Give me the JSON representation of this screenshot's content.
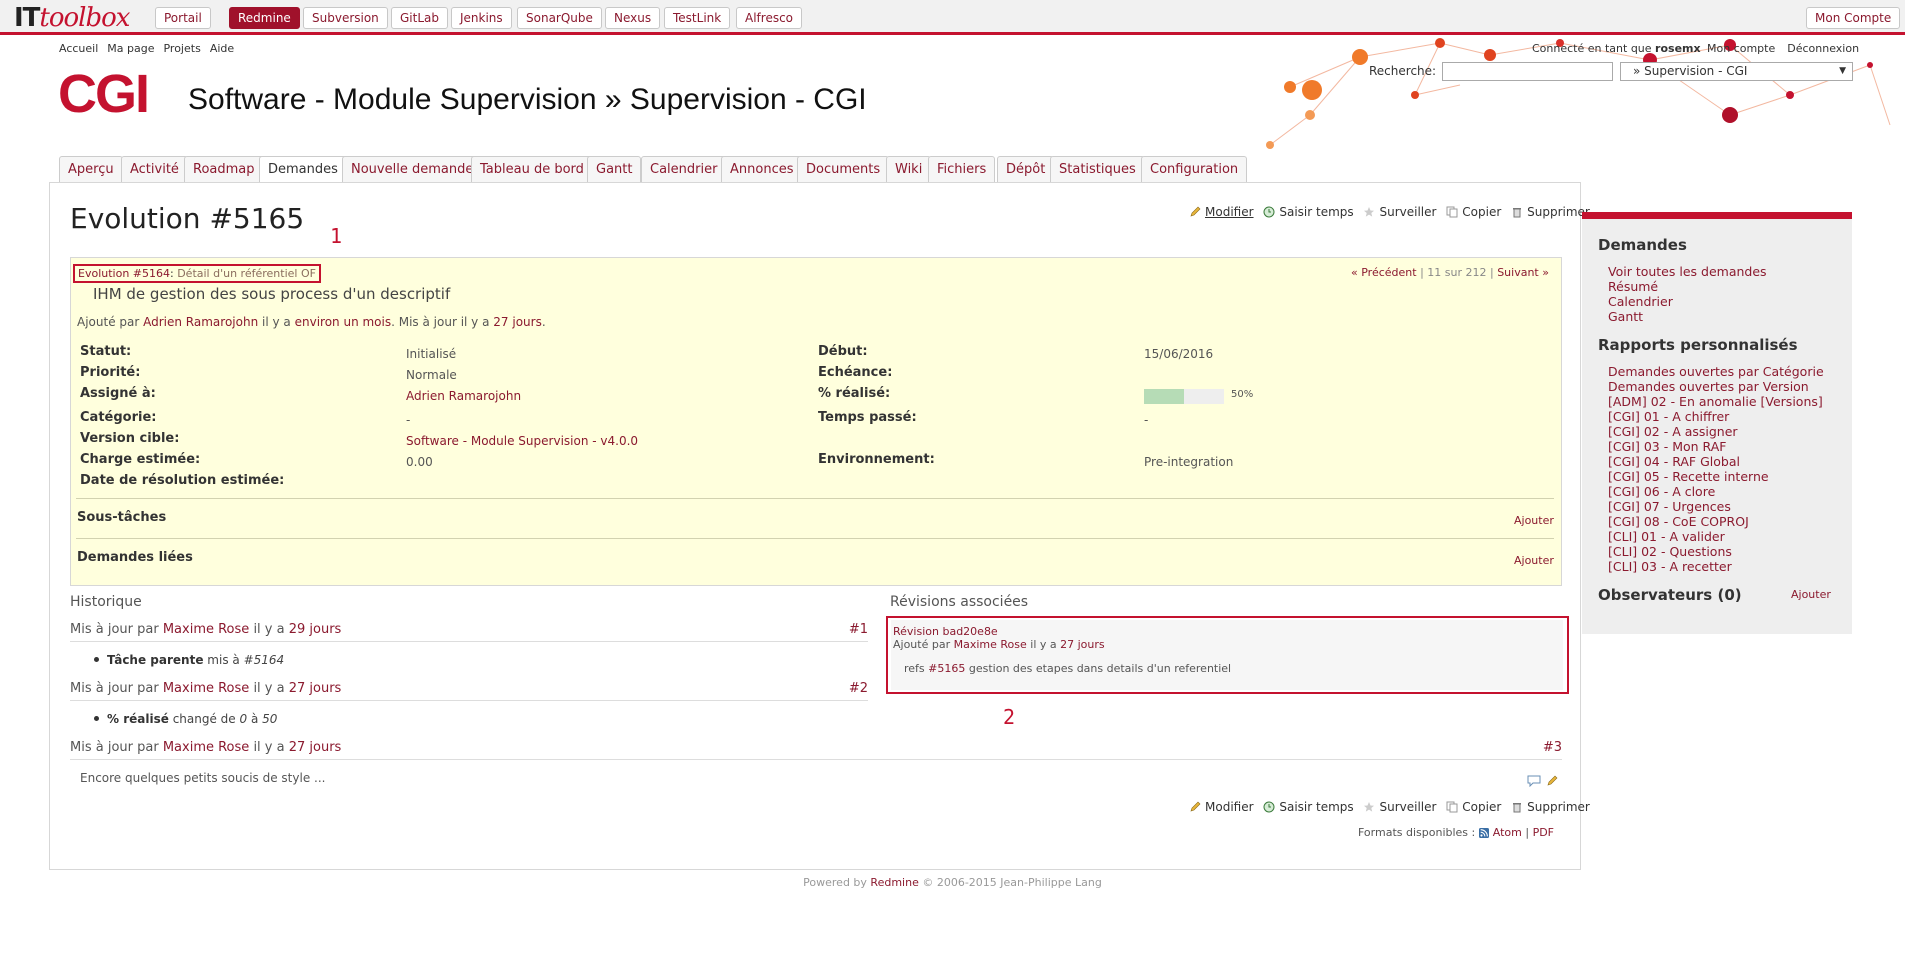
{
  "toolbar": {
    "logo_it": "IT",
    "logo_rest": "toolbox",
    "buttons": [
      "Portail",
      "Redmine",
      "Subversion",
      "GitLab",
      "Jenkins",
      "SonarQube",
      "Nexus",
      "TestLink",
      "Alfresco"
    ],
    "active": "Redmine",
    "account": "Mon Compte"
  },
  "header": {
    "menu_left": [
      "Accueil",
      "Ma page",
      "Projets",
      "Aide"
    ],
    "loggedas_prefix": "Connecté en tant que",
    "loggedas_user": "rosemx",
    "menu_right": [
      "Mon compte",
      "Déconnexion"
    ],
    "logo": "CGI",
    "title": "Software - Module Supervision » Supervision - CGI",
    "search_label": "Recherche:",
    "search_value": "",
    "project_select": "» Supervision - CGI"
  },
  "tabs": [
    "Aperçu",
    "Activité",
    "Roadmap",
    "Demandes",
    "Nouvelle demande",
    "Tableau de bord",
    "Gantt",
    "Calendrier",
    "Annonces",
    "Documents",
    "Wiki",
    "Fichiers",
    "Dépôt",
    "Statistiques",
    "Configuration"
  ],
  "selected_tab": "Demandes",
  "issue": {
    "title": "Evolution #5165",
    "actions": [
      "Modifier",
      "Saisir temps",
      "Surveiller",
      "Copier",
      "Supprimer"
    ],
    "parent_link": "Evolution #5164",
    "parent_subject": "Détail d'un référentiel OF",
    "subject": "IHM de gestion des sous process d'un descriptif",
    "author_prefix": "Ajouté par",
    "author": "Adrien Ramarojohn",
    "author_mid": "il y a",
    "created": "environ un mois",
    "updated_mid": ". Mis à jour il y a",
    "updated": "27 jours",
    "nav_prev": "« Précédent",
    "nav_count": "11 sur 212",
    "nav_next": "Suivant »",
    "attributes": {
      "statut_l": "Statut:",
      "statut_v": "Initialisé",
      "priorite_l": "Priorité:",
      "priorite_v": "Normale",
      "assigne_l": "Assigné à:",
      "assigne_v": "Adrien Ramarojohn",
      "categorie_l": "Catégorie:",
      "categorie_v": "-",
      "version_l": "Version cible:",
      "version_v": "Software - Module Supervision - v4.0.0",
      "charge_l": "Charge estimée:",
      "charge_v": "0.00",
      "date_res_l": "Date de résolution estimée:",
      "debut_l": "Début:",
      "debut_v": "15/06/2016",
      "echeance_l": "Echéance:",
      "realise_l": "% réalisé:",
      "realise_pct": 50,
      "realise_txt": "50%",
      "temps_l": "Temps passé:",
      "temps_v": "-",
      "env_l": "Environnement:",
      "env_v": "Pre-integration"
    },
    "subtasks": "Sous-tâches",
    "related": "Demandes liées",
    "add": "Ajouter"
  },
  "history": {
    "title": "Historique",
    "journals": [
      {
        "prefix": "Mis à jour par",
        "user": "Maxime Rose",
        "mid": "il y a",
        "ago": "29 jours",
        "num": "#1"
      },
      {
        "prefix": "Mis à jour par",
        "user": "Maxime Rose",
        "mid": "il y a",
        "ago": "27 jours",
        "num": "#2"
      },
      {
        "prefix": "Mis à jour par",
        "user": "Maxime Rose",
        "mid": "il y a",
        "ago": "27 jours",
        "num": "#3"
      }
    ],
    "detail1_label": "Tâche parente",
    "detail1_text": "mis à",
    "detail1_val": "#5164",
    "detail2_label": "% réalisé",
    "detail2_text": "changé de",
    "detail2_from": "0",
    "detail2_to_word": "à",
    "detail2_to": "50",
    "note": "Encore quelques petits soucis de style ..."
  },
  "revisions": {
    "title": "Révisions associées",
    "rev": "Révision bad20e8e",
    "author_prefix": "Ajouté par",
    "author": "Maxime Rose",
    "author_mid": "il y a",
    "ago": "27 jours",
    "msg_prefix": "refs",
    "msg_ref": "#5165",
    "msg_text": "gestion des etapes dans details d'un referentiel"
  },
  "annotations": {
    "one": "1",
    "two": "2"
  },
  "formats": {
    "label": "Formats disponibles :",
    "atom": "Atom",
    "sep": "|",
    "pdf": "PDF"
  },
  "sidebar": {
    "h_demandes": "Demandes",
    "demandes_links": [
      "Voir toutes les demandes",
      "Résumé",
      "Calendrier",
      "Gantt"
    ],
    "h_rapports": "Rapports personnalisés",
    "rapports_links": [
      "Demandes ouvertes par Catégorie",
      "Demandes ouvertes par Version",
      "[ADM] 02 - En anomalie [Versions]",
      "[CGI] 01 - A chiffrer",
      "[CGI] 02 - A assigner",
      "[CGI] 03 - Mon RAF",
      "[CGI] 04 - RAF Global",
      "[CGI] 05 - Recette interne",
      "[CGI] 06 - A clore",
      "[CGI] 07 - Urgences",
      "[CGI] 08 - CoE COPROJ",
      "[CLI] 01 - A valider",
      "[CLI] 02 - Questions",
      "[CLI] 03 - A recetter"
    ],
    "h_observers": "Observateurs (0)",
    "add": "Ajouter"
  },
  "footer": {
    "prefix": "Powered by",
    "link": "Redmine",
    "suffix": "© 2006-2015 Jean-Philippe Lang"
  },
  "colors": {
    "accent": "#c4122f",
    "link": "#8b1a2f",
    "issue_bg": "#ffffdd"
  }
}
